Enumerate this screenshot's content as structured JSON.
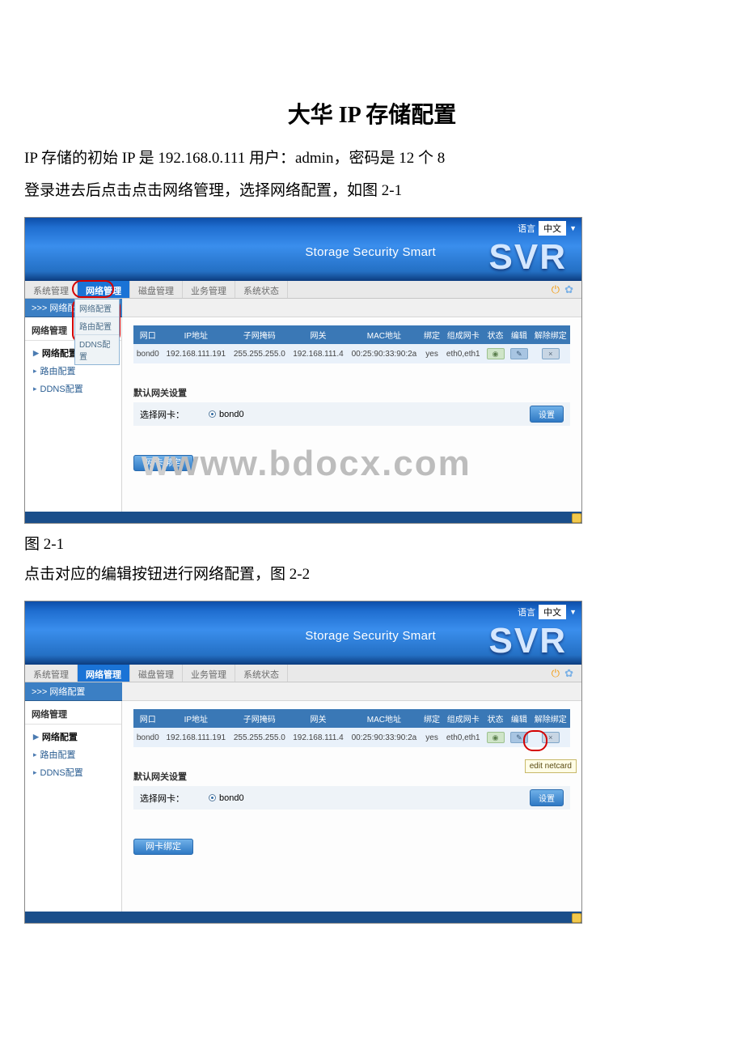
{
  "doc": {
    "title": "大华 IP 存储配置",
    "para1": "IP 存储的初始 IP 是 192.168.0.111 用户：admin，密码是 12 个 8",
    "para2": "登录进去后点击点击网络管理，选择网络配置，如图 2-1",
    "fig1_label": "图 2-1",
    "para3": "点击对应的编辑按钮进行网络配置，图 2-2"
  },
  "app": {
    "lang_label": "语言",
    "lang_value": "中文",
    "brand_text": "Storage Security Smart",
    "svr_logo": "SVR",
    "top_tabs": [
      "系统管理",
      "网络管理",
      "磁盘管理",
      "业务管理",
      "系统状态"
    ],
    "active_tab_index": 1,
    "crumb": ">>> 网络配置",
    "dropdown_items": [
      "网络配置",
      "路由配置",
      "DDNS配置"
    ],
    "side_header": "网络管理",
    "side_items": [
      {
        "label": "网络配置",
        "level": 1
      },
      {
        "label": "路由配置",
        "level": 2
      },
      {
        "label": "DDNS配置",
        "level": 2
      }
    ],
    "table": {
      "headers": [
        "网口",
        "IP地址",
        "子网掩码",
        "网关",
        "MAC地址",
        "绑定",
        "组成网卡",
        "状态",
        "编辑",
        "解除绑定"
      ],
      "row": {
        "port": "bond0",
        "ip": "192.168.111.191",
        "mask": "255.255.255.0",
        "gw": "192.168.111.4",
        "mac": "00:25:90:33:90:2a",
        "bind": "yes",
        "nics": "eth0,eth1"
      }
    },
    "gateway_section": {
      "title": "默认网关设置",
      "select_label": "选择网卡：",
      "option": "bond0",
      "set_btn": "设置"
    },
    "bind_btn": "网卡绑定",
    "tooltip": "edit netcard",
    "watermark": "www.bdocx.com"
  }
}
